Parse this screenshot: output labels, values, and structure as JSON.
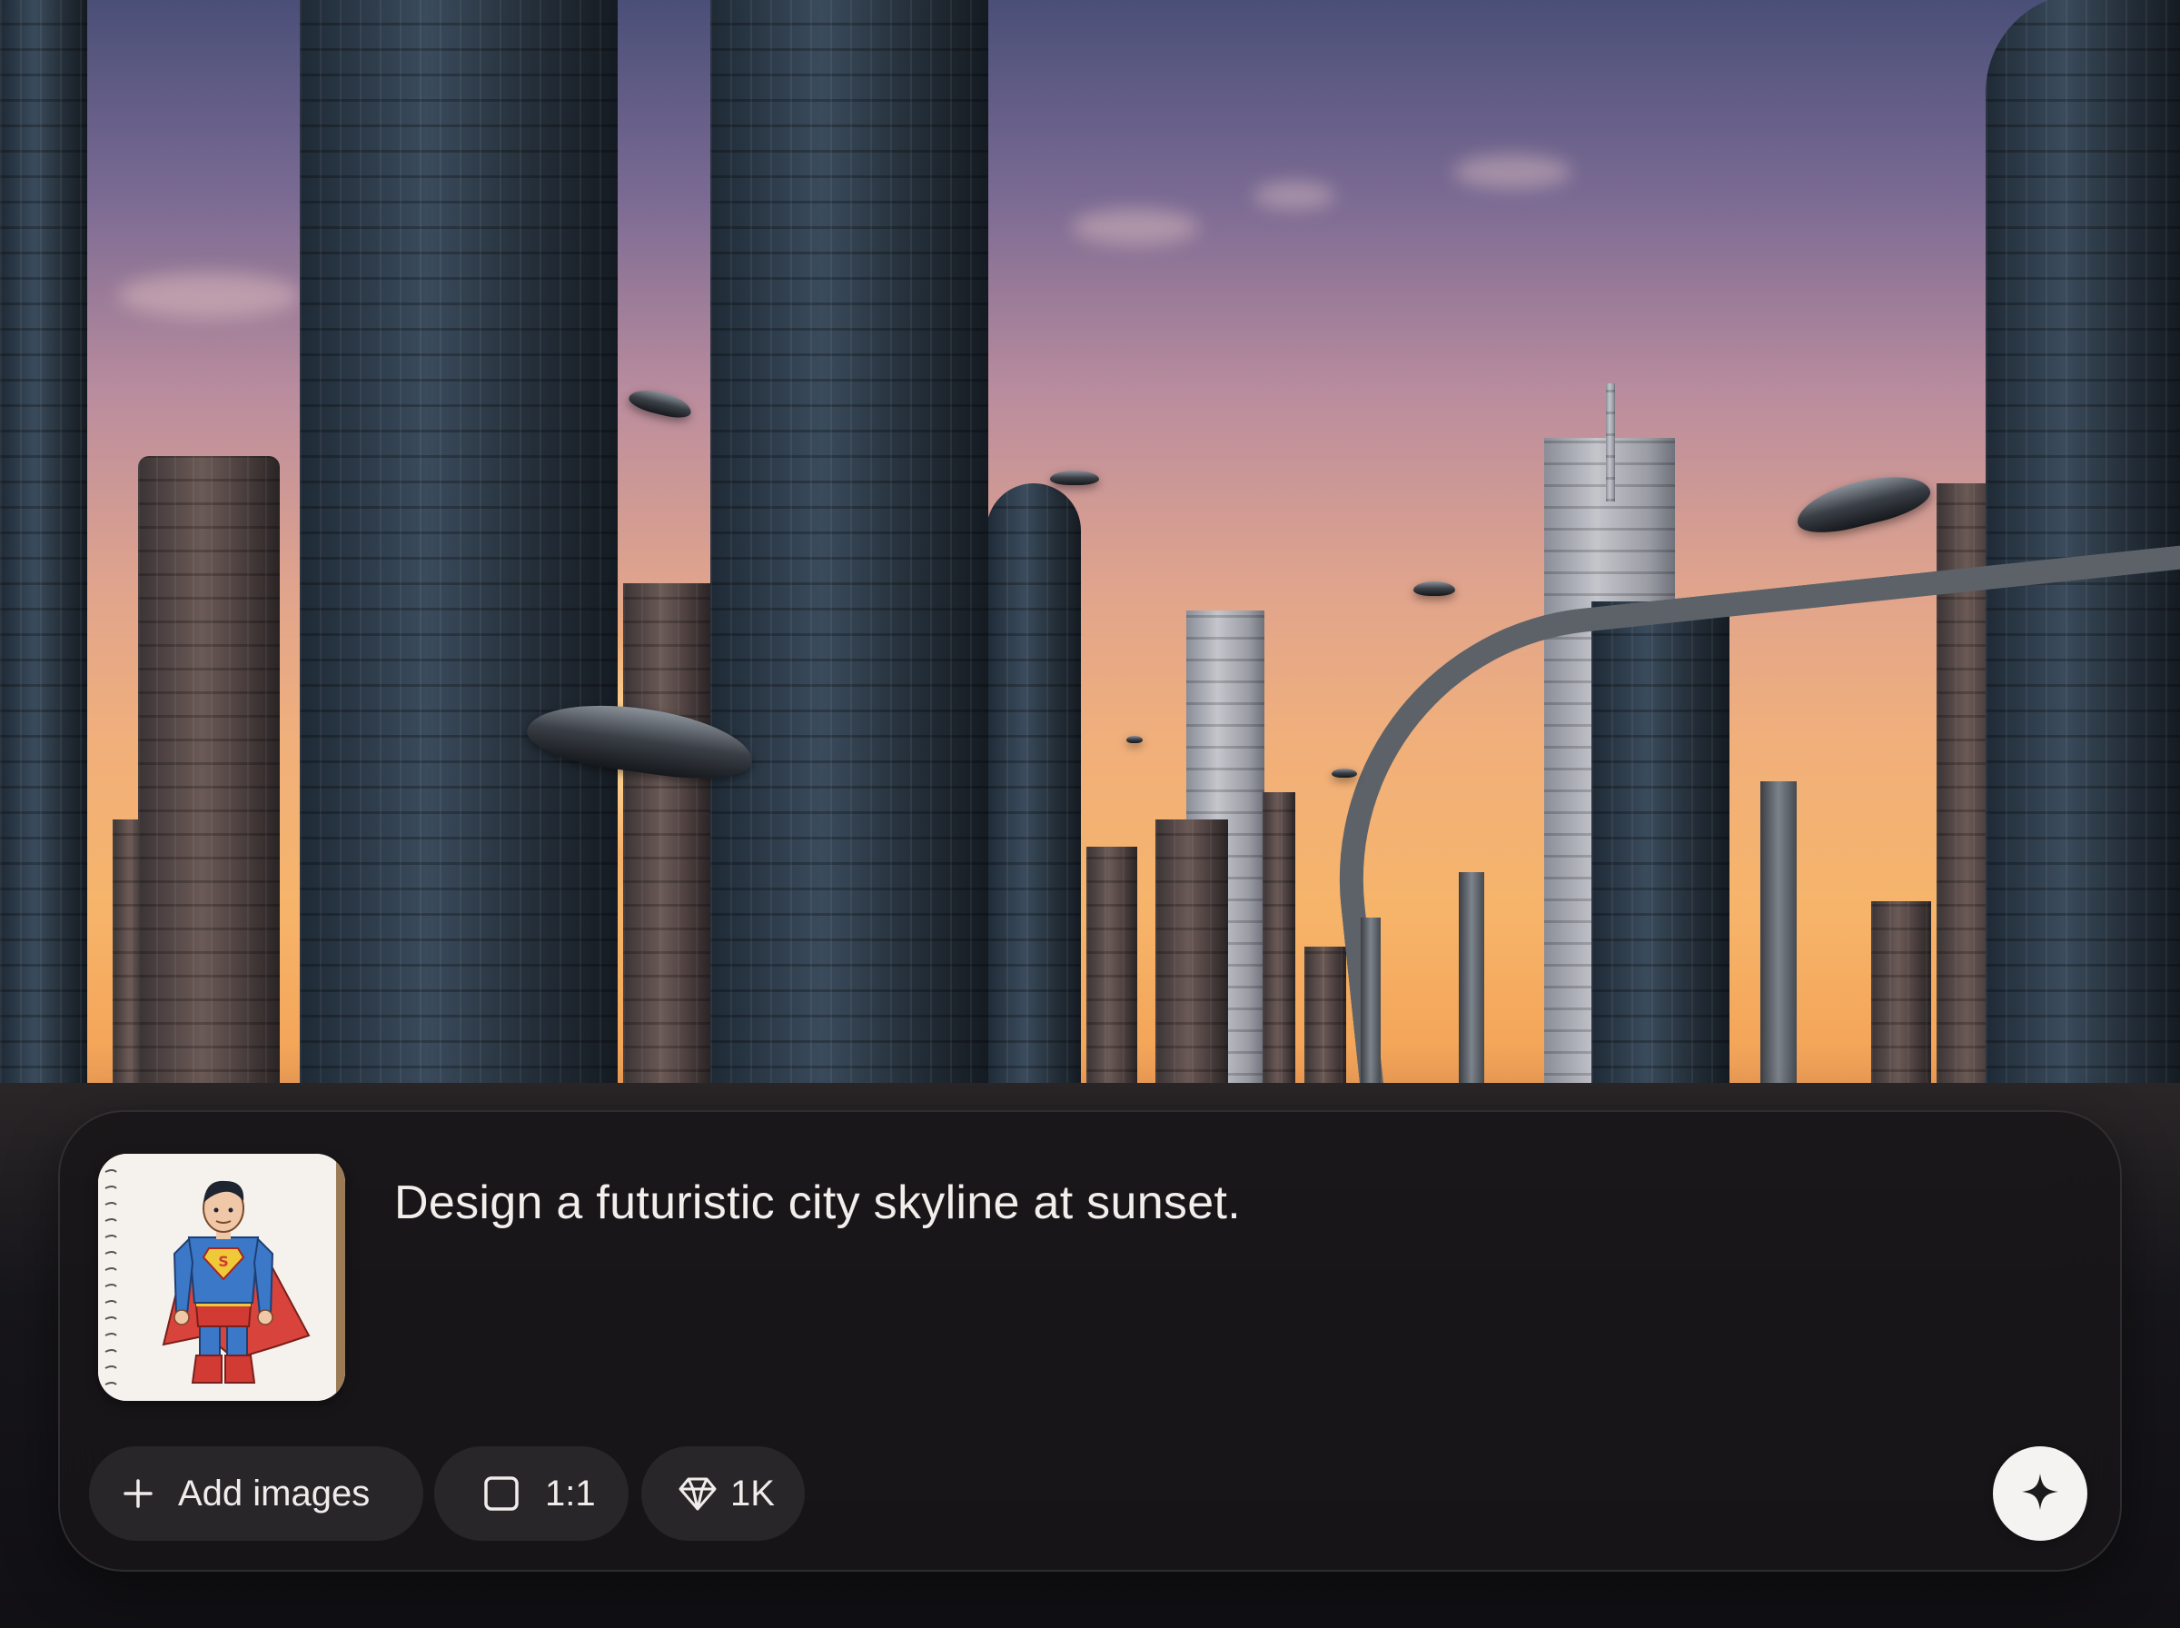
{
  "background": {
    "scene": "futuristic city skyline at sunset",
    "colors": {
      "sky_top": "#4a4f78",
      "sky_mid": "#e0a48d",
      "sun_glow": "#f6b46a",
      "ground": "#17161a"
    }
  },
  "composer": {
    "attachment": {
      "icon": "superman-sketch-thumbnail"
    },
    "prompt_text": "Design a futuristic city skyline at sunset.",
    "toolbar": {
      "add_images": {
        "icon": "plus-icon",
        "label": "Add images"
      },
      "aspect_ratio": {
        "icon": "square-icon",
        "label": "1:1"
      },
      "resolution": {
        "icon": "diamond-icon",
        "label": "1K"
      }
    },
    "send_button": {
      "icon": "sparkle-icon"
    },
    "colors": {
      "panel_bg": "#181618",
      "text": "#f1eeeb",
      "chip_bg": "#2e2b2d",
      "send_bg": "#f4f3f2"
    }
  }
}
